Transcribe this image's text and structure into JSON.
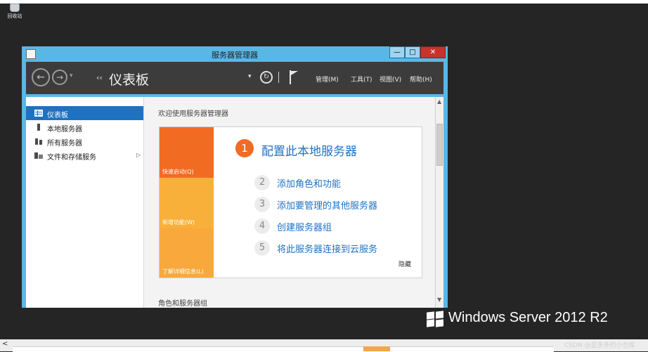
{
  "desktop": {
    "recycle_bin_label": "回收站"
  },
  "window": {
    "title": "服务器管理器",
    "min_symbol": "—",
    "max_symbol": "□",
    "close_symbol": "✕"
  },
  "navbar": {
    "breadcrumb_arrows": "‹‹",
    "breadcrumb": "仪表板",
    "menus": [
      "管理(M)",
      "工具(T)",
      "视图(V)",
      "帮助(H)"
    ]
  },
  "sidebar": {
    "items": [
      {
        "label": "仪表板",
        "icon": "dashboard-icon",
        "active": true
      },
      {
        "label": "本地服务器",
        "icon": "server-icon"
      },
      {
        "label": "所有服务器",
        "icon": "servers-icon"
      },
      {
        "label": "文件和存储服务",
        "icon": "storage-icon",
        "expand": "▷"
      }
    ]
  },
  "main": {
    "welcome": "欢迎使用服务器管理器",
    "tiles": [
      "快速启动(Q)",
      "新增功能(W)",
      "了解详细信息(L)"
    ],
    "step1": {
      "num": "1",
      "label": "配置此本地服务器"
    },
    "steps": [
      {
        "num": "2",
        "label": "添加角色和功能"
      },
      {
        "num": "3",
        "label": "添加要管理的其他服务器"
      },
      {
        "num": "4",
        "label": "创建服务器组"
      },
      {
        "num": "5",
        "label": "将此服务器连接到云服务"
      }
    ],
    "hide": "隐藏",
    "roles_section": "角色和服务器组"
  },
  "branding": {
    "windows": "Windows Server 2012 R2",
    "watermark": "CSDN @蓝多多的小仓库"
  },
  "colors": {
    "accent_blue": "#1f72c2",
    "tile_orange": "#f26b22",
    "tile_yellow": "#f9b03a",
    "window_frame": "#59b7e6",
    "close_red": "#c7332b"
  }
}
